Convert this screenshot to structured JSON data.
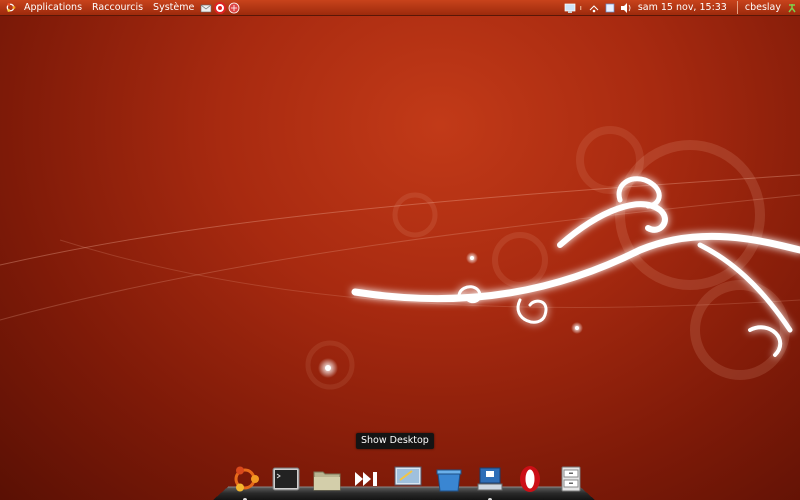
{
  "top_panel": {
    "menus": [
      "Applications",
      "Raccourcis",
      "Système"
    ],
    "clock": "sam 15 nov, 15:33",
    "user": "cbeslay"
  },
  "tooltip": {
    "text": "Show Desktop"
  },
  "dock": {
    "items": [
      {
        "name": "ubuntu-menu",
        "icon": "ubuntu-logo-icon",
        "running": true
      },
      {
        "name": "terminal",
        "icon": "terminal-icon",
        "running": false
      },
      {
        "name": "file-manager",
        "icon": "folder-icon",
        "running": false
      },
      {
        "name": "media-player",
        "icon": "skip-forward-icon",
        "running": false
      },
      {
        "name": "show-desktop",
        "icon": "show-desktop-icon",
        "running": false
      },
      {
        "name": "package-manager",
        "icon": "blue-box-icon",
        "running": false
      },
      {
        "name": "network-manager",
        "icon": "network-computer-icon",
        "running": true
      },
      {
        "name": "opera-browser",
        "icon": "opera-icon",
        "running": false
      },
      {
        "name": "archive-manager",
        "icon": "file-cabinet-icon",
        "running": false
      }
    ]
  },
  "colors": {
    "panel": "#b8381a",
    "wallpaper": "#a82a10",
    "tooltip_bg": "#141414"
  }
}
